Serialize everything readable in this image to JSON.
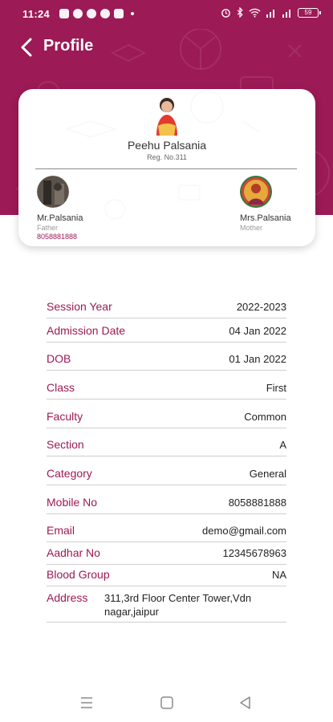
{
  "status_bar": {
    "time": "11:24",
    "battery": "59",
    "left_icons": [
      "app-icon",
      "message-icon",
      "browser-icon",
      "facebook-icon",
      "gmail-icon"
    ],
    "right_icons": [
      "alarm-icon",
      "bluetooth-icon",
      "wifi-icon",
      "signal-icon",
      "signal-icon"
    ]
  },
  "header": {
    "title": "Profile",
    "color": "#9c1a55"
  },
  "student": {
    "name": "Peehu Palsania",
    "reg_no": "Reg. No.311"
  },
  "father": {
    "name": "Mr.Palsania",
    "relation": "Father",
    "phone": "8058881888"
  },
  "mother": {
    "name": "Mrs.Palsania",
    "relation": "Mother"
  },
  "details": [
    {
      "label": "Session Year",
      "value": "2022-2023"
    },
    {
      "label": "Admission Date",
      "value": "04 Jan 2022"
    },
    {
      "label": "DOB",
      "value": "01 Jan 2022"
    },
    {
      "label": "Class",
      "value": "First"
    },
    {
      "label": "Faculty",
      "value": "Common"
    },
    {
      "label": "Section",
      "value": "A"
    },
    {
      "label": "Category",
      "value": "General"
    },
    {
      "label": "Mobile No",
      "value": "8058881888"
    },
    {
      "label": "Email",
      "value": "demo@gmail.com"
    },
    {
      "label": "Aadhar No",
      "value": "12345678963"
    },
    {
      "label": "Blood Group",
      "value": "NA"
    },
    {
      "label": "Address",
      "value": "311,3rd Floor Center Tower,Vdn nagar,jaipur"
    }
  ],
  "nav": [
    "menu-icon",
    "home-icon",
    "back-icon"
  ]
}
